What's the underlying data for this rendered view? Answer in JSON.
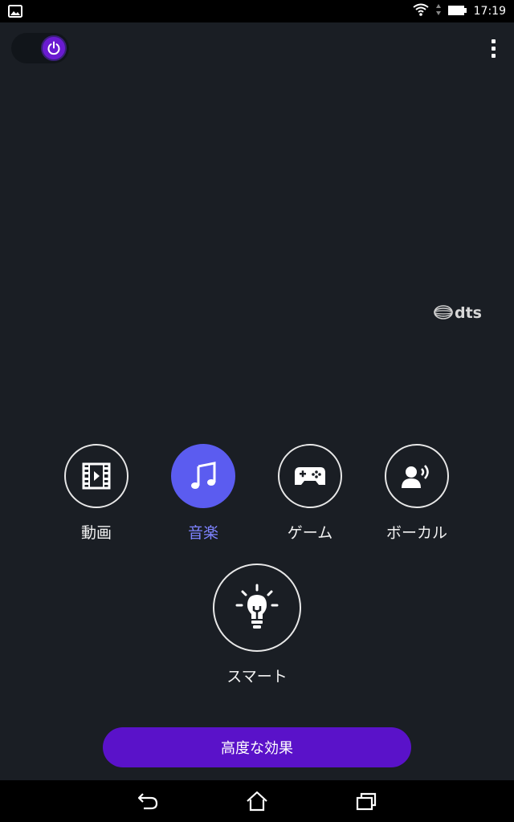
{
  "status_bar": {
    "time": "17:19",
    "icons": [
      "image-icon",
      "wifi-icon",
      "battery-icon"
    ]
  },
  "header": {
    "power_toggle_state": "on",
    "menu_icon": "overflow-menu-icon"
  },
  "brand": {
    "logo_text": "dts"
  },
  "modes": [
    {
      "id": "movie",
      "label": "動画",
      "icon": "film-icon",
      "active": false
    },
    {
      "id": "music",
      "label": "音楽",
      "icon": "music-note-icon",
      "active": true
    },
    {
      "id": "game",
      "label": "ゲーム",
      "icon": "gamepad-icon",
      "active": false
    },
    {
      "id": "vocal",
      "label": "ボーカル",
      "icon": "voice-icon",
      "active": false
    },
    {
      "id": "smart",
      "label": "スマート",
      "icon": "lightbulb-icon",
      "active": false
    }
  ],
  "advanced_button": {
    "label": "高度な効果"
  },
  "nav_bar": {
    "icons": [
      "back-icon",
      "home-icon",
      "recents-icon"
    ]
  },
  "colors": {
    "background": "#1a1e24",
    "accent": "#5b5cf0",
    "accent_text": "#7d82ff",
    "button": "#5a12c9"
  }
}
